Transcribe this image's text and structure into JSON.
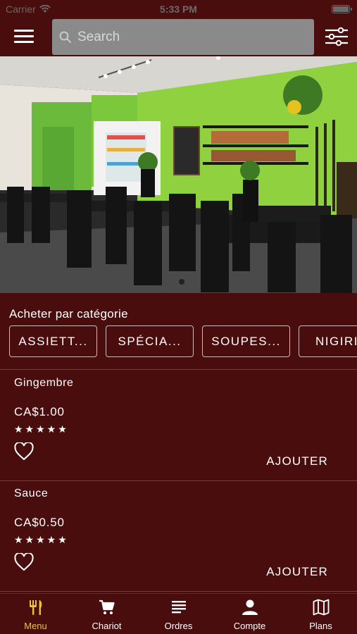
{
  "status_bar": {
    "carrier": "Carrier",
    "time": "5:33 PM"
  },
  "search": {
    "placeholder": "Search"
  },
  "categories": {
    "title": "Acheter par catégorie",
    "items": [
      "ASSIETT...",
      "SPÉCIA...",
      "SOUPES...",
      "NIGIRI"
    ]
  },
  "products": [
    {
      "name": "Gingembre",
      "price": "CA$1.00",
      "stars": "★★★★★",
      "add_label": "AJOUTER"
    },
    {
      "name": "Sauce",
      "price": "CA$0.50",
      "stars": "★★★★★",
      "add_label": "AJOUTER"
    }
  ],
  "tabs": [
    {
      "label": "Menu",
      "icon": "fork-knife-icon",
      "active": true
    },
    {
      "label": "Chariot",
      "icon": "cart-icon",
      "active": false
    },
    {
      "label": "Ordres",
      "icon": "list-icon",
      "active": false
    },
    {
      "label": "Compte",
      "icon": "person-icon",
      "active": false
    },
    {
      "label": "Plans",
      "icon": "map-icon",
      "active": false
    }
  ],
  "colors": {
    "background": "#4a0d0d",
    "active_tab": "#e6c33c",
    "search_bg": "#8a8a8a"
  }
}
